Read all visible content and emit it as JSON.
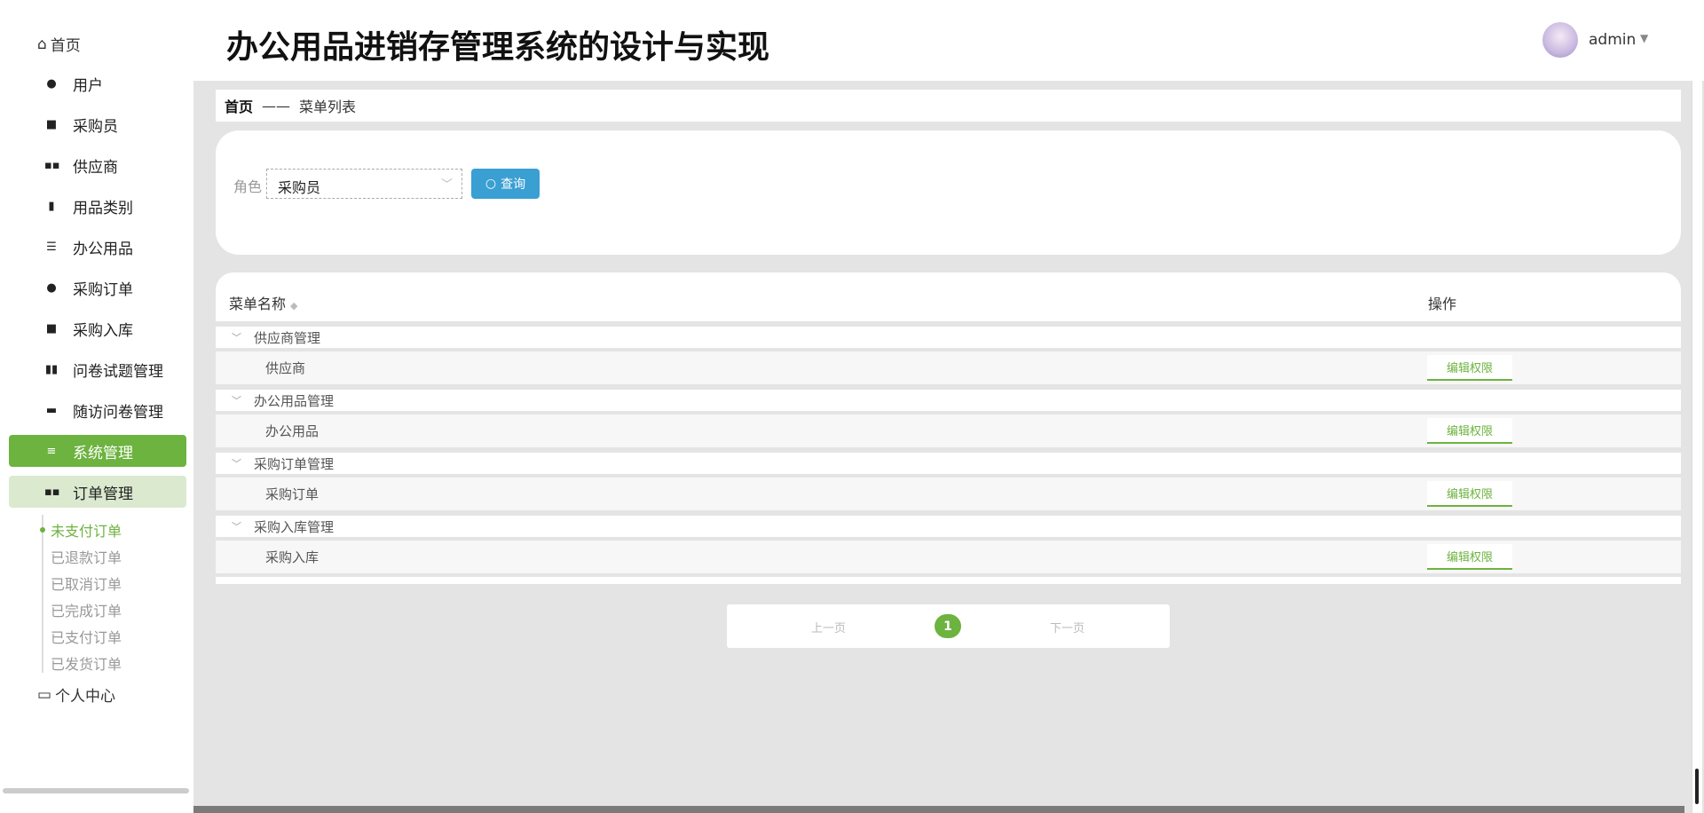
{
  "sidebar": {
    "home": "首页",
    "items": [
      {
        "label": "用户",
        "icon": "user-icon"
      },
      {
        "label": "采购员",
        "icon": "briefcase-icon"
      },
      {
        "label": "供应商",
        "icon": "grid-icon"
      },
      {
        "label": "用品类别",
        "icon": "clipboard-icon"
      },
      {
        "label": "办公用品",
        "icon": "list-icon"
      },
      {
        "label": "采购订单",
        "icon": "bulb-icon"
      },
      {
        "label": "采购入库",
        "icon": "wallet-icon"
      },
      {
        "label": "问卷试题管理",
        "icon": "bar-chart-icon"
      },
      {
        "label": "随访问卷管理",
        "icon": "comment-icon"
      },
      {
        "label": "系统管理",
        "icon": "sliders-icon"
      },
      {
        "label": "订单管理",
        "icon": "grid-icon"
      }
    ],
    "sub_items": [
      "未支付订单",
      "已退款订单",
      "已取消订单",
      "已完成订单",
      "已支付订单",
      "已发货订单"
    ],
    "personal": "个人中心",
    "accent": "#6db33f"
  },
  "header": {
    "title": "办公用品进销存管理系统的设计与实现",
    "user": "admin"
  },
  "breadcrumb": {
    "home": "首页",
    "sep": "——",
    "current": "菜单列表"
  },
  "search": {
    "role_label": "角色",
    "role_value": "采购员",
    "query_label": "查询"
  },
  "table": {
    "col_name": "菜单名称",
    "col_op": "操作",
    "edit_label": "编辑权限",
    "groups": [
      {
        "name": "供应商管理",
        "child": "供应商"
      },
      {
        "name": "办公用品管理",
        "child": "办公用品"
      },
      {
        "name": "采购订单管理",
        "child": "采购订单"
      },
      {
        "name": "采购入库管理",
        "child": "采购入库"
      }
    ]
  },
  "pager": {
    "prev": "上一页",
    "page": "1",
    "next": "下一页"
  }
}
